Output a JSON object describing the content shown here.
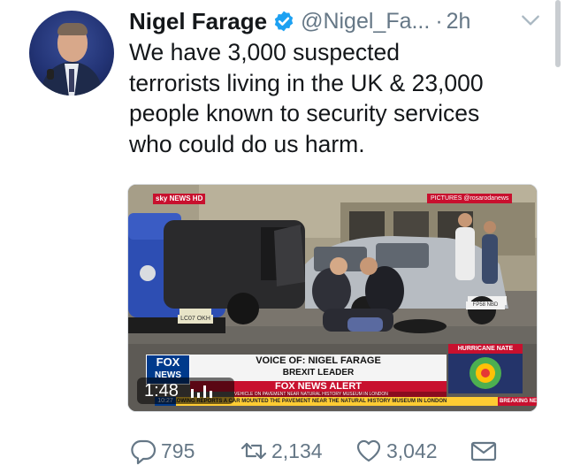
{
  "tweet": {
    "author_name": "Nigel Farage",
    "handle": "@Nigel_Fa...",
    "dot": "·",
    "time": "2h",
    "text_lines": [
      "We have 3,000 suspected",
      "terrorists living in the UK & 23,000",
      "people known to security services",
      "who could do us harm."
    ]
  },
  "media": {
    "channel_logo": "sky NEWS HD",
    "pictures_credit": "PICTURES @rosarodanews",
    "plate_front": "LC07 OKH",
    "plate_silver": "FP58 NBD",
    "network_logo_top": "FOX",
    "network_logo_bottom": "NEWS",
    "lower_third_title": "VOICE OF: NIGEL FARAGE",
    "lower_third_sub": "BREXIT LEADER",
    "alert_label": "FOX NEWS ALERT",
    "ticker_small": "VEHICLE ON PAVEMENT NEAR NATURAL HISTORY MUSEUM IN LONDON",
    "ticker_text": "...FOLLOWING REPORTS A CAR MOUNTED THE PAVEMENT NEAR THE NATURAL HISTORY MUSEUM IN LONDON",
    "ticker_clock": "10:27",
    "breaking_label": "BREAKING NE",
    "hurricane_label": "HURRICANE NATE",
    "duration": "1:48",
    "views_icon": "views-bars-icon"
  },
  "actions": {
    "reply_count": "795",
    "retweet_count": "2,134",
    "like_count": "3,042"
  },
  "icons": {
    "verified": "verified-badge-icon",
    "caret": "chevron-down-icon",
    "reply": "reply-icon",
    "retweet": "retweet-icon",
    "like": "heart-icon",
    "dm": "envelope-icon"
  },
  "colors": {
    "verified_blue": "#1da1f2",
    "secondary_text": "#657786",
    "primary_text": "#14171a",
    "fox_red": "#c8102e",
    "fox_blue": "#003a8c"
  }
}
